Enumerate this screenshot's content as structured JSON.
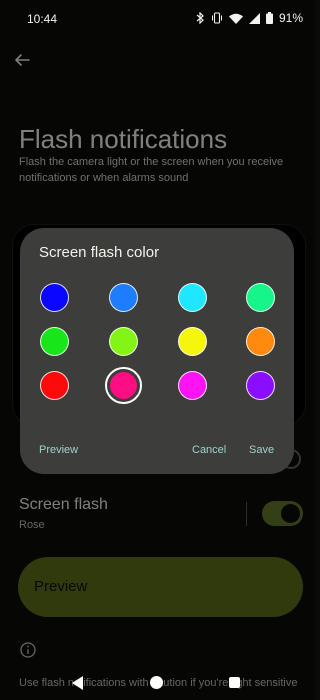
{
  "status_bar": {
    "time": "10:44",
    "battery": "91%",
    "icons": [
      "bluetooth-icon",
      "vibrate-icon",
      "wifi-icon",
      "signal-icon",
      "battery-icon"
    ]
  },
  "page": {
    "title": "Flash notifications",
    "description": "Flash the camera light or the screen when you receive notifications or when alarms sound",
    "screen_flash": {
      "title": "Screen flash",
      "subtitle": "Rose",
      "enabled": true
    },
    "preview_label": "Preview",
    "footer_text": "Use flash notifications with caution if you're light sensitive"
  },
  "dialog": {
    "title": "Screen flash color",
    "colors": [
      {
        "name": "blue",
        "hex": "#0a06ff",
        "selected": false
      },
      {
        "name": "azure",
        "hex": "#1e7dff",
        "selected": false
      },
      {
        "name": "cyan",
        "hex": "#1ee7ff",
        "selected": false
      },
      {
        "name": "spring-green",
        "hex": "#16f58a",
        "selected": false
      },
      {
        "name": "green",
        "hex": "#18e61a",
        "selected": false
      },
      {
        "name": "chartreuse",
        "hex": "#82f516",
        "selected": false
      },
      {
        "name": "yellow",
        "hex": "#f5f50d",
        "selected": false
      },
      {
        "name": "orange",
        "hex": "#ff8a0d",
        "selected": false
      },
      {
        "name": "red",
        "hex": "#ff0a0a",
        "selected": false
      },
      {
        "name": "rose",
        "hex": "#ff0d82",
        "selected": true
      },
      {
        "name": "magenta",
        "hex": "#ff13f5",
        "selected": false
      },
      {
        "name": "violet",
        "hex": "#8a0dff",
        "selected": false
      }
    ],
    "buttons": {
      "preview": "Preview",
      "cancel": "Cancel",
      "save": "Save"
    }
  },
  "colors": {
    "accent_button_text": "#9fd2c7",
    "toggle_track": "#5f7327",
    "preview_button_bg": "#5a6b16"
  }
}
